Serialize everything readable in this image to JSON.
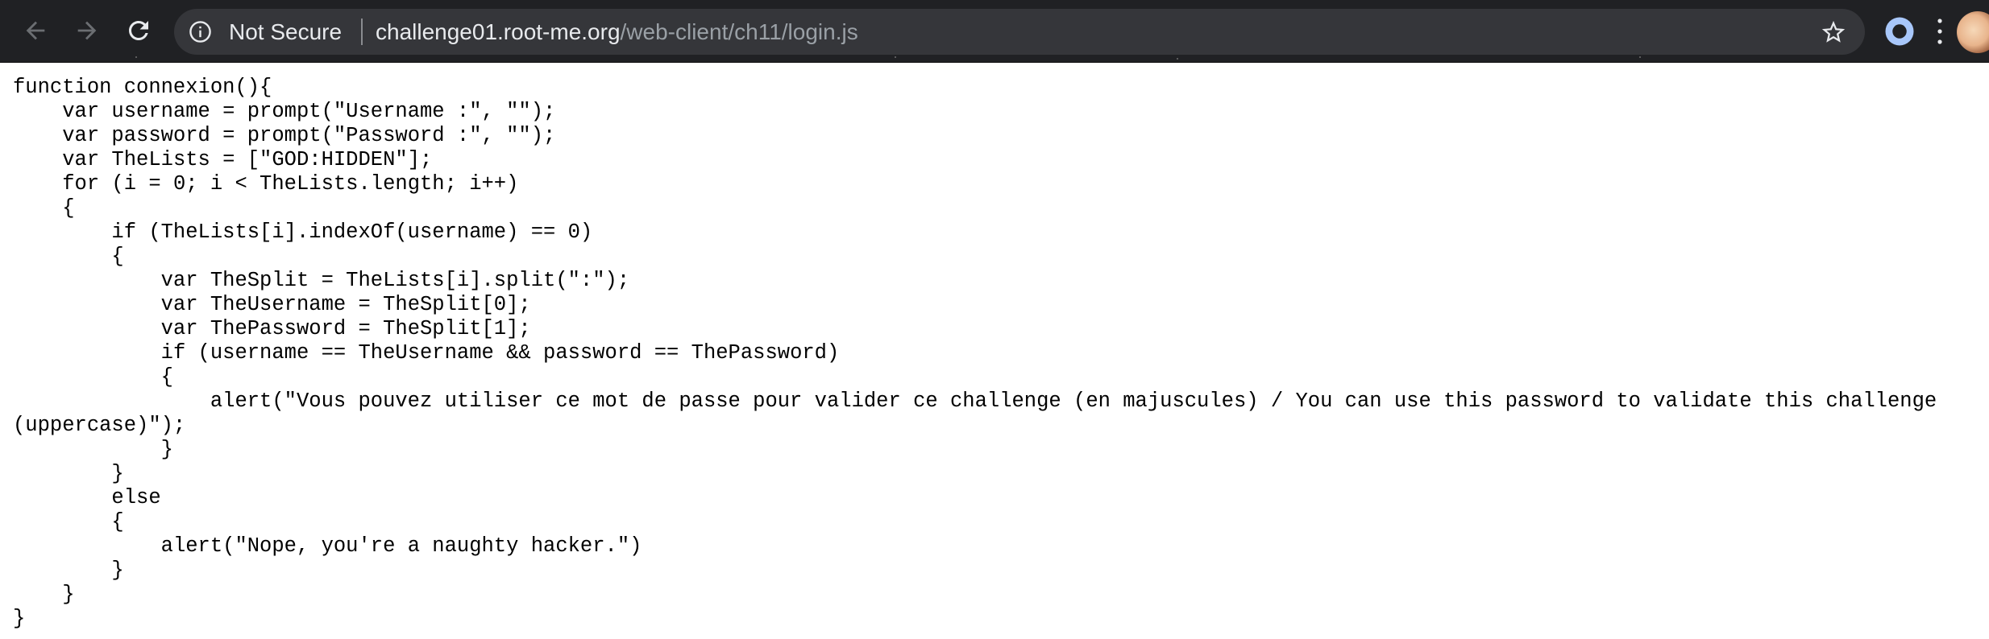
{
  "browser": {
    "nav": {
      "back_icon": "arrow-back-icon",
      "forward_icon": "arrow-forward-icon",
      "reload_icon": "reload-icon"
    },
    "omnibox": {
      "info_icon": "info-icon",
      "security_label": "Not Secure",
      "url_host": "challenge01.root-me.org",
      "url_path": "/web-client/ch11/login.js",
      "bookmark_icon": "star-icon"
    },
    "extension_icon": "ring-icon",
    "menu_icon": "kebab-icon",
    "profile_icon": "avatar"
  },
  "colors": {
    "toolbar_bg": "#202124",
    "omnibox_bg": "#35363a",
    "text_primary": "#e8eaed",
    "text_secondary": "#9aa0a6",
    "page_bg": "#ffffff",
    "code_text": "#000000"
  },
  "document": {
    "lines": [
      "function connexion(){",
      "    var username = prompt(\"Username :\", \"\");",
      "    var password = prompt(\"Password :\", \"\");",
      "    var TheLists = [\"GOD:HIDDEN\"];",
      "    for (i = 0; i < TheLists.length; i++)",
      "    {",
      "        if (TheLists[i].indexOf(username) == 0)",
      "        {",
      "            var TheSplit = TheLists[i].split(\":\");",
      "            var TheUsername = TheSplit[0];",
      "            var ThePassword = TheSplit[1];",
      "            if (username == TheUsername && password == ThePassword)",
      "            {",
      "                alert(\"Vous pouvez utiliser ce mot de passe pour valider ce challenge (en majuscules) / You can use this password to validate this challenge (uppercase)\");",
      "            }",
      "        }",
      "        else",
      "        {",
      "            alert(\"Nope, you're a naughty hacker.\")",
      "        }",
      "    }",
      "}"
    ]
  }
}
